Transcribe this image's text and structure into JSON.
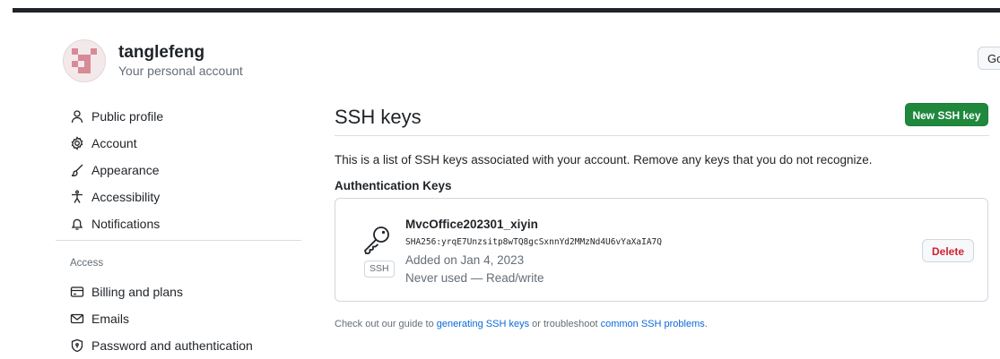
{
  "profile": {
    "username": "tanglefeng",
    "subtitle": "Your personal account",
    "go_button": "Go"
  },
  "nav": {
    "items": [
      {
        "label": "Public profile",
        "icon": "person-icon"
      },
      {
        "label": "Account",
        "icon": "gear-icon"
      },
      {
        "label": "Appearance",
        "icon": "paintbrush-icon"
      },
      {
        "label": "Accessibility",
        "icon": "accessibility-icon"
      },
      {
        "label": "Notifications",
        "icon": "bell-icon"
      }
    ],
    "access_heading": "Access",
    "access_items": [
      {
        "label": "Billing and plans",
        "icon": "credit-card-icon"
      },
      {
        "label": "Emails",
        "icon": "mail-icon"
      },
      {
        "label": "Password and authentication",
        "icon": "shield-lock-icon"
      }
    ]
  },
  "main": {
    "title": "SSH keys",
    "new_button": "New SSH key",
    "description": "This is a list of SSH keys associated with your account. Remove any keys that you do not recognize.",
    "section_heading": "Authentication Keys",
    "keys": [
      {
        "name": "MvcOffice202301_xiyin",
        "fingerprint": "SHA256:yrqE7Unzsitp8wTQ8gcSxnnYd2MMzNd4U6vYaXaIA7Q",
        "added": "Added on Jan 4, 2023",
        "usage": "Never used — Read/write",
        "badge": "SSH",
        "delete_label": "Delete"
      }
    ],
    "footer": {
      "prefix": "Check out our guide to ",
      "link1": "generating SSH keys",
      "middle": " or troubleshoot ",
      "link2": "common SSH problems",
      "suffix": "."
    }
  },
  "colors": {
    "accent_green": "#1f883d",
    "danger": "#cf222e",
    "link": "#0969da"
  }
}
